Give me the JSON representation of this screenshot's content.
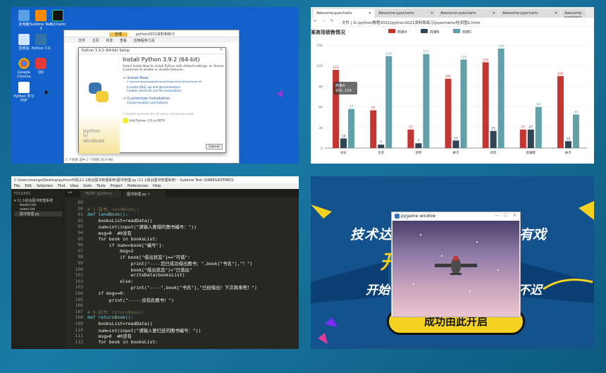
{
  "desktop": {
    "icons": [
      {
        "label": "此电脑"
      },
      {
        "label": "Sublime Text 3"
      },
      {
        "label": "PyCharm"
      },
      {
        "label": "回收站"
      },
      {
        "label": "Python 3.9"
      },
      {
        "label": "Google Chrome"
      },
      {
        "label": "QQ"
      },
      {
        "label": "Python 学习 PDF"
      }
    ],
    "explorer_tab": "管理",
    "explorer_title": "python2021资料和练习",
    "explorer_tabs": [
      "文件",
      "主页",
      "共享",
      "查看",
      "应用程序工具"
    ],
    "explorer_status": "5 个项目    选中 1 个项目 26.9 MB",
    "setup": {
      "title": "Python 3.9.2 (64-bit) Setup",
      "heading": "Install Python 3.9.2 (64-bit)",
      "desc": "Select Install Now to install Python with default settings, or choose Customize to enable or disable features.",
      "install_now": "Install Now",
      "install_path": "C:\\Users\\mango\\AppData\\Local\\Programs\\Python\\Python39",
      "install_notes": [
        "Includes IDLE, pip and documentation",
        "Creates shortcuts and file associations"
      ],
      "customize": "Customize installation",
      "customize_note": "Choose location and features",
      "chk_launcher": "Install launcher for all users (recommended)",
      "chk_path": "Add Python 3.9 to PATH",
      "cancel": "Cancel",
      "logo_line1": "python",
      "logo_line2": "for",
      "logo_line3": "windows"
    }
  },
  "browser": {
    "tabs": [
      "Awesome-pyecharts",
      "Awesome-pyecharts",
      "Awesome-pyecharts",
      "Awesome-pyecharts",
      "Awesome-pyecharts"
    ],
    "address": "文件  |  G:/python教程2021/python2021资料和练习/pyecharts/柱状图2.html",
    "tooltip_title": "商家A",
    "tooltip_value": "衬衫: 114"
  },
  "chart_data": {
    "type": "bar",
    "title": "某商场销售情况",
    "categories": [
      "衬衫",
      "毛衣",
      "领带",
      "裤子",
      "风衣",
      "高跟鞋",
      "袜子"
    ],
    "series": [
      {
        "name": "商家A",
        "values": [
          114,
          55,
          27,
          101,
          125,
          27,
          105
        ],
        "color": "#c23531"
      },
      {
        "name": "商家B",
        "values": [
          14,
          5,
          7,
          11,
          25,
          27,
          10
        ],
        "color": "#2f4554"
      },
      {
        "name": "商家C",
        "values": [
          57,
          134,
          137,
          129,
          145,
          60,
          49
        ],
        "color": "#61a0a8"
      }
    ],
    "yticks": [
      0,
      30,
      60,
      90,
      120,
      150
    ],
    "ylim": [
      0,
      150
    ],
    "legend": "top-center"
  },
  "sublime": {
    "title": "C:\\Users\\mango\\Desktop\\python代码\\11.1综合图书管理系统\\图书管理.py (11.1综合图书管理系统) - Sublime Text (UNREGISTERED)",
    "menu": [
      "File",
      "Edit",
      "Selection",
      "Find",
      "View",
      "Goto",
      "Tools",
      "Project",
      "Preferences",
      "Help"
    ],
    "folders_label": "FOLDERS",
    "folder": "11.1综合图书管理系统",
    "files": [
      "books.txt",
      "users.txt",
      "图书管理.py"
    ],
    "tab1": "*RUN* [python]",
    "tab2": "图书管理.py",
    "lines": [
      {
        "n": "89",
        "t": ""
      },
      {
        "n": "90",
        "t": "# 5.借书：lendBook()"
      },
      {
        "n": "91",
        "t": "def lendBook():"
      },
      {
        "n": "92",
        "t": "    booksList=readData()"
      },
      {
        "n": "93",
        "t": "    num=int(input(\"请输入要借的图书编号：\"))"
      },
      {
        "n": "94",
        "t": "    msg=0  #0没有"
      },
      {
        "n": "95",
        "t": "    for book in booksList:"
      },
      {
        "n": "96",
        "t": "        if num==book[\"编号\"]:"
      },
      {
        "n": "97",
        "t": "            msg=2"
      },
      {
        "n": "98",
        "t": "            if book[\"借出状态\"]==\"可借\":"
      },
      {
        "n": "99",
        "t": "                print(\"----您已成功借出图书：\",book[\"书名\"],\"！\")"
      },
      {
        "n": "100",
        "t": "                book[\"借出状态\"]=\"已借出\""
      },
      {
        "n": "101",
        "t": "                writeData(booksList)"
      },
      {
        "n": "102",
        "t": "            else:"
      },
      {
        "n": "103",
        "t": "                print(\"----\",book[\"书名\"],\"已经借出！下次再来吧！\")"
      },
      {
        "n": "104",
        "t": "    if msg==0:"
      },
      {
        "n": "105",
        "t": "        print(\"-----没有此图书！\")"
      },
      {
        "n": "106",
        "t": ""
      },
      {
        "n": "107",
        "t": "# 6.还书：returnBook()"
      },
      {
        "n": "108",
        "t": "def returnBook():"
      },
      {
        "n": "109",
        "t": "    booksList=readData()"
      },
      {
        "n": "110",
        "t": "    num=int(input(\"请输入要归还的图书编号：\"))"
      },
      {
        "n": "111",
        "t": "    msg=0  #0没有"
      },
      {
        "n": "112",
        "t": "    for book in booksList:"
      }
    ]
  },
  "game": {
    "window_title": "pygame window",
    "banner_left": "技术达",
    "banner_right": "有戏",
    "banner_big": "开",
    "line2_left": "开始",
    "line2_right": "不迟",
    "bottom": "成功由此开启"
  }
}
